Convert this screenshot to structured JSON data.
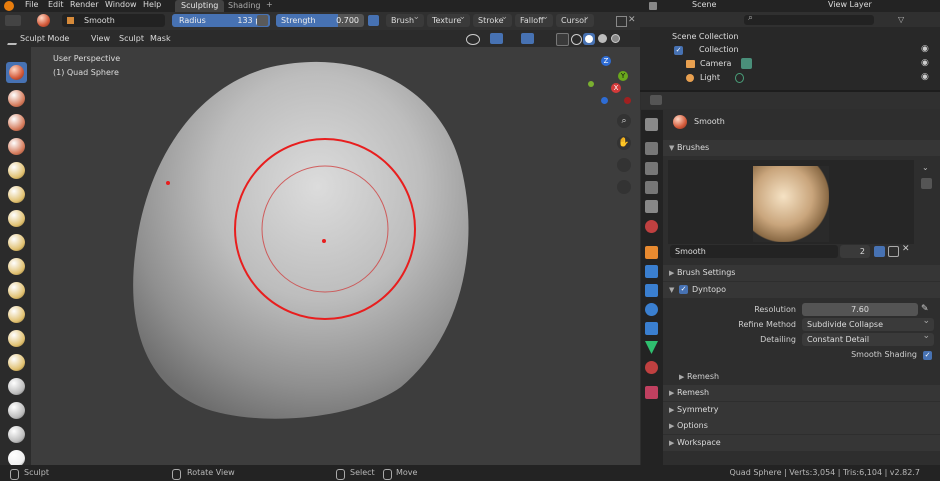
{
  "menubar": {
    "items": [
      "File",
      "Edit",
      "Render",
      "Window",
      "Help"
    ],
    "workspace_tabs": [
      "Sculpting",
      "Shading"
    ],
    "add_tab": "+",
    "scene": "Scene",
    "view_layer": "View Layer"
  },
  "tool_header": {
    "brush_name": "Smooth",
    "radius_label": "Radius",
    "radius_value": "133 px",
    "strength_label": "Strength",
    "strength_value": "0.700",
    "strength_fraction": 0.7,
    "dropdowns": [
      "Brush",
      "Texture",
      "Stroke",
      "Falloff",
      "Cursor"
    ]
  },
  "view_header": {
    "mode": "Sculpt Mode",
    "menus": [
      "View",
      "Sculpt",
      "Mask"
    ]
  },
  "viewport": {
    "perspective": "User Perspective",
    "object": "(1) Quad Sphere",
    "gizmo_z": "Z",
    "gizmo_y": "Y",
    "gizmo_x": "X"
  },
  "outliner": {
    "scene_collection": "Scene Collection",
    "collection": "Collection",
    "camera": "Camera",
    "light": "Light"
  },
  "properties": {
    "active_tool": "Smooth",
    "brushes_section": "Brushes",
    "brush_name_field": "Smooth",
    "brush_users": "2",
    "brush_settings": "Brush Settings",
    "dyntopo": "Dyntopo",
    "resolution_label": "Resolution",
    "resolution_value": "7.60",
    "refine_method_label": "Refine Method",
    "refine_method_value": "Subdivide Collapse",
    "detailing_label": "Detailing",
    "detailing_value": "Constant Detail",
    "smooth_shading": "Smooth Shading",
    "remesh_sub": "Remesh",
    "remesh": "Remesh",
    "symmetry": "Symmetry",
    "options": "Options",
    "workspace": "Workspace"
  },
  "statusbar": {
    "sculpt": "Sculpt",
    "rotate_view": "Rotate View",
    "select": "Select",
    "move": "Move",
    "stats": "Quad Sphere | Verts:3,054 | Tris:6,104 | v2.82.7"
  },
  "colors": {
    "accent": "#4772b3",
    "brush_circle": "#e81e1e"
  }
}
